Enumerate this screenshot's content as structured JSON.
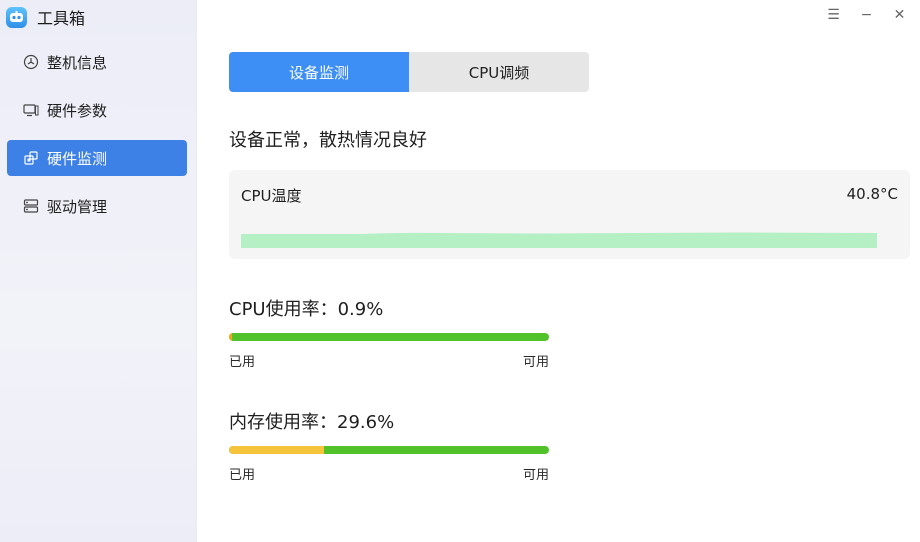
{
  "app": {
    "title": "工具箱"
  },
  "sidebar": {
    "items": [
      {
        "label": "整机信息",
        "icon": "clock-icon",
        "active": false
      },
      {
        "label": "硬件参数",
        "icon": "monitor-icon",
        "active": false
      },
      {
        "label": "硬件监测",
        "icon": "chip-icon",
        "active": true
      },
      {
        "label": "驱动管理",
        "icon": "server-icon",
        "active": false
      }
    ]
  },
  "window_controls": {
    "menu": "☰",
    "minimize": "−",
    "close": "✕"
  },
  "tabs": [
    {
      "label": "设备监测",
      "active": true
    },
    {
      "label": "CPU调频",
      "active": false
    }
  ],
  "status_text": "设备正常，散热情况良好",
  "cpu_temp": {
    "label": "CPU温度",
    "value": "40.8°C"
  },
  "cpu_usage": {
    "title": "CPU使用率：0.9%",
    "fraction": 0.009,
    "used_label": "已用",
    "free_label": "可用"
  },
  "mem_usage": {
    "title": "内存使用率：29.6%",
    "fraction": 0.296,
    "used_label": "已用",
    "free_label": "可用"
  },
  "colors": {
    "accent": "#3d80e6",
    "tab_active": "#3d8ff5",
    "bar_free": "#52c22b",
    "cpu_used": "#f0a81c",
    "mem_used": "#f5c43a",
    "temp_graph": "#b5efc4"
  }
}
